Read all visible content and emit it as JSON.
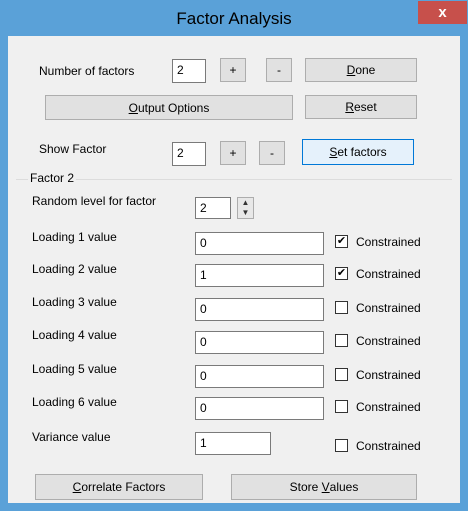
{
  "window": {
    "title": "Factor Analysis",
    "close_label": "x"
  },
  "top": {
    "num_factors_label": "Number of factors",
    "num_factors_value": "2",
    "plus": "+",
    "minus": "-",
    "done_prefix": "D",
    "done_rest": "one",
    "output_prefix": "O",
    "output_rest": "utput Options",
    "reset_prefix": "R",
    "reset_rest": "eset",
    "show_factor_label": "Show Factor",
    "show_factor_value": "2",
    "set_prefix": "S",
    "set_rest": "et factors"
  },
  "factor": {
    "group_title": "Factor 2",
    "random_level_label": "Random level for factor",
    "random_level_value": "2",
    "loadings": [
      {
        "label": "Loading 1 value",
        "value": "0",
        "constrained": true,
        "check_label": "Constrained"
      },
      {
        "label": "Loading 2 value",
        "value": "1",
        "constrained": true,
        "check_label": "Constrained"
      },
      {
        "label": "Loading 3 value",
        "value": "0",
        "constrained": false,
        "check_label": "Constrained"
      },
      {
        "label": "Loading 4 value",
        "value": "0",
        "constrained": false,
        "check_label": "Constrained"
      },
      {
        "label": "Loading 5 value",
        "value": "0",
        "constrained": false,
        "check_label": "Constrained"
      },
      {
        "label": "Loading 6 value",
        "value": "0",
        "constrained": false,
        "check_label": "Constrained"
      }
    ],
    "variance_label": "Variance value",
    "variance_value": "1",
    "variance_check_label": "Constrained"
  },
  "bottom": {
    "correlate_prefix": "C",
    "correlate_rest": "orrelate Factors",
    "store_prefix": "Store ",
    "store_u": "V",
    "store_rest": "alues"
  }
}
